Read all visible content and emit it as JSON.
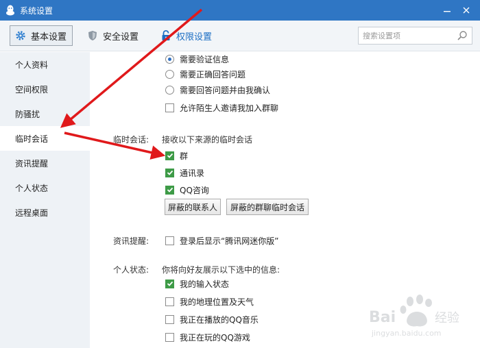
{
  "window": {
    "title": "系统设置",
    "minimize": "—",
    "close": "✕"
  },
  "toolbar": {
    "tabs": [
      {
        "label": "基本设置",
        "icon": "gear-icon",
        "active": true
      },
      {
        "label": "安全设置",
        "icon": "shield-icon"
      },
      {
        "label": "权限设置",
        "icon": "lock-icon"
      }
    ],
    "search": {
      "placeholder": "搜索设置项",
      "value": ""
    }
  },
  "sidebar": {
    "items": [
      {
        "label": "个人资料"
      },
      {
        "label": "空间权限"
      },
      {
        "label": "防骚扰"
      },
      {
        "label": "临时会话",
        "active": true
      },
      {
        "label": "资讯提醒"
      },
      {
        "label": "个人状态"
      },
      {
        "label": "远程桌面"
      }
    ]
  },
  "main": {
    "verify_options": [
      {
        "label": "需要验证信息",
        "checked": true
      },
      {
        "label": "需要正确回答问题",
        "checked": false
      },
      {
        "label": "需要回答问题并由我确认",
        "checked": false
      }
    ],
    "allow_stranger_invite": {
      "label": "允许陌生人邀请我加入群聊",
      "checked": false
    },
    "temp_session": {
      "label": "临时会话:",
      "desc": "接收以下来源的临时会话",
      "options": [
        {
          "label": "群",
          "checked": true
        },
        {
          "label": "通讯录",
          "checked": true
        },
        {
          "label": "QQ咨询",
          "checked": true
        }
      ],
      "buttons": {
        "blocked_contacts": "屏蔽的联系人",
        "blocked_group_sessions": "屏蔽的群聊临时会话"
      }
    },
    "news": {
      "label": "资讯提醒:",
      "option": "登录后显示“腾讯网迷你版”",
      "checked": false
    },
    "status": {
      "label": "个人状态:",
      "desc": "你将向好友展示以下选中的信息:",
      "options": [
        {
          "label": "我的输入状态",
          "checked": true
        },
        {
          "label": "我的地理位置及天气",
          "checked": false
        },
        {
          "label": "我正在播放的QQ音乐",
          "checked": false
        },
        {
          "label": "我正在玩的QQ游戏",
          "checked": false
        }
      ]
    }
  },
  "watermark": {
    "brand": "Bai度经验",
    "url": "jingyan.baidu.com"
  },
  "colors": {
    "titlebar": "#2f76c4",
    "accent_blue": "#1d6fc4",
    "check_green": "#3e9b47",
    "arrow_red": "#e0191b",
    "sidebar_bg": "#eef2f6"
  }
}
